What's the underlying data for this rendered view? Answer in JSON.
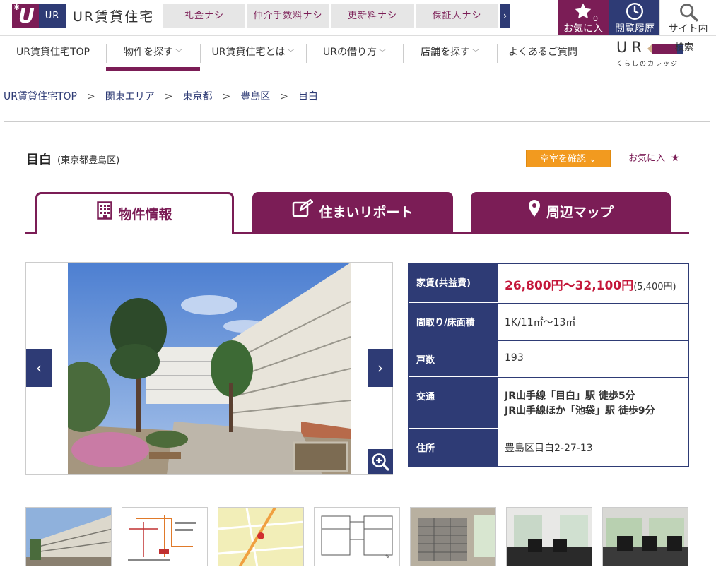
{
  "header": {
    "logo_ur": "UR",
    "logo_text": "UR賃貸住宅",
    "feature_tabs": [
      "礼金ナシ",
      "仲介手数料ナシ",
      "更新料ナシ",
      "保証人ナシ"
    ],
    "feature_next": "›",
    "favorites_label": "お気に入",
    "favorites_count": "0",
    "history_label": "閲覧履歴",
    "search_label": "サイト内",
    "search_label2": "検索"
  },
  "nav": {
    "items": [
      "UR賃貸住宅TOP",
      "物件を探す",
      "UR賃貸住宅とは",
      "URの借り方",
      "店舗を探す",
      "よくあるご質問"
    ],
    "college_title": "UR",
    "college_sub": "くらしのカレッジ"
  },
  "breadcrumb": [
    "UR賃貸住宅TOP",
    "関東エリア",
    "東京都",
    "豊島区",
    "目白"
  ],
  "breadcrumb_sep": ">",
  "property": {
    "name": "目白",
    "area": "(東京都豊島区)",
    "vacancy_button": "空室を確認",
    "favorite_button": "お気に入",
    "tabs": [
      "物件情報",
      "住まいリポート",
      "周辺マップ"
    ]
  },
  "gallery": {
    "prev": "‹",
    "next": "›"
  },
  "info": {
    "rows": [
      {
        "label": "家賃(共益費)",
        "value_main": "26,800円〜32,100円",
        "value_sub": "(5,400円)"
      },
      {
        "label": "間取り/床面積",
        "value": "1K/11㎡〜13㎡"
      },
      {
        "label": "戸数",
        "value": "193"
      },
      {
        "label": "交通",
        "line1": "JR山手線「目白」駅 徒歩5分",
        "line2": "JR山手線ほか「池袋」駅 徒歩9分"
      },
      {
        "label": "住所",
        "value": "豊島区目白2-27-13"
      }
    ]
  },
  "colors": {
    "brand_purple": "#7b1d56",
    "brand_navy": "#2e3b75",
    "accent_orange": "#f29a1f",
    "rent_red": "#c4173a"
  }
}
